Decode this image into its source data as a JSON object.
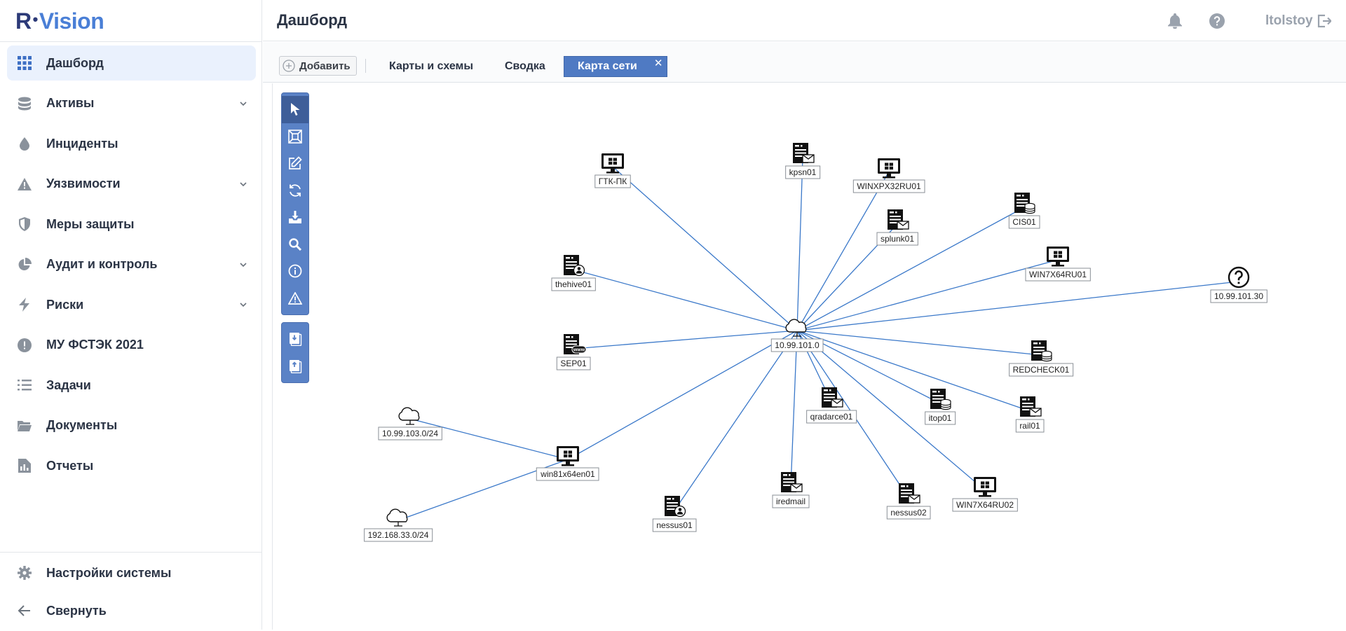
{
  "brand": {
    "r": "R",
    "vision": "Vision"
  },
  "sidebar": {
    "items": [
      {
        "label": "Дашборд",
        "icon": "grid-icon",
        "active": true,
        "expandable": false
      },
      {
        "label": "Активы",
        "icon": "database-icon",
        "active": false,
        "expandable": true
      },
      {
        "label": "Инциденты",
        "icon": "drop-icon",
        "active": false,
        "expandable": false
      },
      {
        "label": "Уязвимости",
        "icon": "warning-icon",
        "active": false,
        "expandable": true
      },
      {
        "label": "Меры защиты",
        "icon": "shield-icon",
        "active": false,
        "expandable": false
      },
      {
        "label": "Аудит и контроль",
        "icon": "pie-icon",
        "active": false,
        "expandable": true
      },
      {
        "label": "Риски",
        "icon": "bolt-icon",
        "active": false,
        "expandable": true
      },
      {
        "label": "МУ ФСТЭК 2021",
        "icon": "exclamation-icon",
        "active": false,
        "expandable": false
      },
      {
        "label": "Задачи",
        "icon": "list-icon",
        "active": false,
        "expandable": false
      },
      {
        "label": "Документы",
        "icon": "folder-icon",
        "active": false,
        "expandable": false
      },
      {
        "label": "Отчеты",
        "icon": "report-icon",
        "active": false,
        "expandable": false
      }
    ],
    "bottom": [
      {
        "label": "Настройки системы",
        "icon": "gear-icon"
      },
      {
        "label": "Свернуть",
        "icon": "arrow-left-icon"
      }
    ]
  },
  "header": {
    "title": "Дашборд",
    "user": "ltolstoy"
  },
  "tabs": {
    "add_label": "Добавить",
    "items": [
      {
        "label": "Карты и схемы",
        "active": false
      },
      {
        "label": "Сводка",
        "active": false
      },
      {
        "label": "Карта сети",
        "active": true
      }
    ],
    "close_glyph": "✕"
  },
  "colors": {
    "accent": "#4f7ac3",
    "active_nav_bg": "#eaf1fd",
    "link_line": "#3a78c9"
  },
  "network_map": {
    "center": "10.99.101.0",
    "nodes": [
      {
        "id": "gtk",
        "label": "ГТК-ПК",
        "type": "workstation"
      },
      {
        "id": "kpsn",
        "label": "kpsn01",
        "type": "server-mail"
      },
      {
        "id": "winxp",
        "label": "WINXPX32RU01",
        "type": "workstation"
      },
      {
        "id": "cis",
        "label": "CIS01",
        "type": "server-db"
      },
      {
        "id": "splunk",
        "label": "splunk01",
        "type": "server-mail"
      },
      {
        "id": "win7a",
        "label": "WIN7X64RU01",
        "type": "workstation"
      },
      {
        "id": "unk",
        "label": "10.99.101.30",
        "type": "unknown"
      },
      {
        "id": "thehive",
        "label": "thehive01",
        "type": "server-user"
      },
      {
        "id": "sep",
        "label": "SEP01",
        "type": "server-www"
      },
      {
        "id": "center",
        "label": "10.99.101.0",
        "type": "cloud"
      },
      {
        "id": "redcheck",
        "label": "REDCHECK01",
        "type": "server-db"
      },
      {
        "id": "qradar",
        "label": "qradarce01",
        "type": "server-mail"
      },
      {
        "id": "itop",
        "label": "itop01",
        "type": "server-db"
      },
      {
        "id": "rail",
        "label": "rail01",
        "type": "server-mail"
      },
      {
        "id": "net103",
        "label": "10.99.103.0/24",
        "type": "cloud"
      },
      {
        "id": "win81",
        "label": "win81x64en01",
        "type": "workstation"
      },
      {
        "id": "iredmail",
        "label": "iredmail",
        "type": "server-mail"
      },
      {
        "id": "nessus02",
        "label": "nessus02",
        "type": "server-mail"
      },
      {
        "id": "win7b",
        "label": "WIN7X64RU02",
        "type": "workstation"
      },
      {
        "id": "nessus01",
        "label": "nessus01",
        "type": "server-user"
      },
      {
        "id": "net192",
        "label": "192.168.33.0/24",
        "type": "cloud"
      }
    ],
    "links": [
      [
        "center",
        "gtk"
      ],
      [
        "center",
        "kpsn"
      ],
      [
        "center",
        "winxp"
      ],
      [
        "center",
        "cis"
      ],
      [
        "center",
        "splunk"
      ],
      [
        "center",
        "win7a"
      ],
      [
        "center",
        "unk"
      ],
      [
        "center",
        "thehive"
      ],
      [
        "center",
        "sep"
      ],
      [
        "center",
        "redcheck"
      ],
      [
        "center",
        "qradar"
      ],
      [
        "center",
        "itop"
      ],
      [
        "center",
        "rail"
      ],
      [
        "center",
        "win81"
      ],
      [
        "center",
        "iredmail"
      ],
      [
        "center",
        "nessus02"
      ],
      [
        "center",
        "win7b"
      ],
      [
        "center",
        "nessus01"
      ],
      [
        "win81",
        "net103"
      ],
      [
        "win81",
        "net192"
      ]
    ]
  }
}
